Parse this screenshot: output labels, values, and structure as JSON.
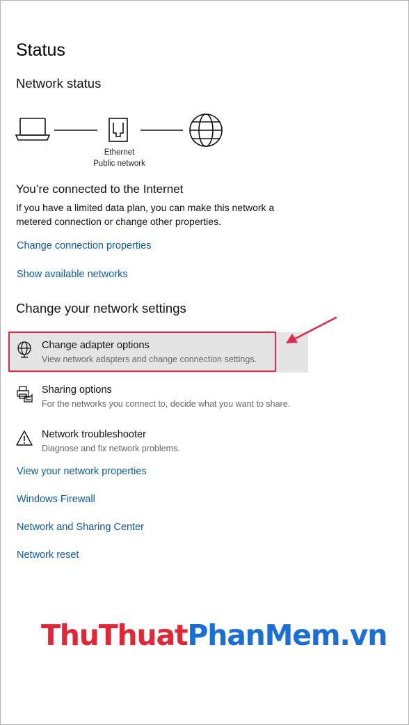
{
  "page": {
    "title": "Status",
    "section_network_status": "Network status"
  },
  "diagram": {
    "connection_type": "Ethernet",
    "network_profile": "Public network"
  },
  "connection": {
    "heading": "You’re connected to the Internet",
    "description": "If you have a limited data plan, you can make this network a metered connection or change other properties."
  },
  "links_top": {
    "change_connection_properties": "Change connection properties",
    "show_available_networks": "Show available networks"
  },
  "section_change_settings": "Change your network settings",
  "options": [
    {
      "icon": "adapter-globe-icon",
      "title": "Change adapter options",
      "subtitle": "View network adapters and change connection settings."
    },
    {
      "icon": "sharing-printer-icon",
      "title": "Sharing options",
      "subtitle": "For the networks you connect to, decide what you want to share."
    },
    {
      "icon": "warning-triangle-icon",
      "title": "Network troubleshooter",
      "subtitle": "Diagnose and fix network problems."
    }
  ],
  "links_bottom": {
    "view_network_properties": "View your network properties",
    "windows_firewall": "Windows Firewall",
    "network_sharing_center": "Network and Sharing Center",
    "network_reset": "Network reset"
  },
  "watermark": {
    "part1": "ThuThuat",
    "part2": "PhanMem",
    "part3": ".vn"
  },
  "colors": {
    "link": "#0b5aa6",
    "highlight_bg": "#e4e4e4",
    "annotation_red": "#e0284a"
  }
}
